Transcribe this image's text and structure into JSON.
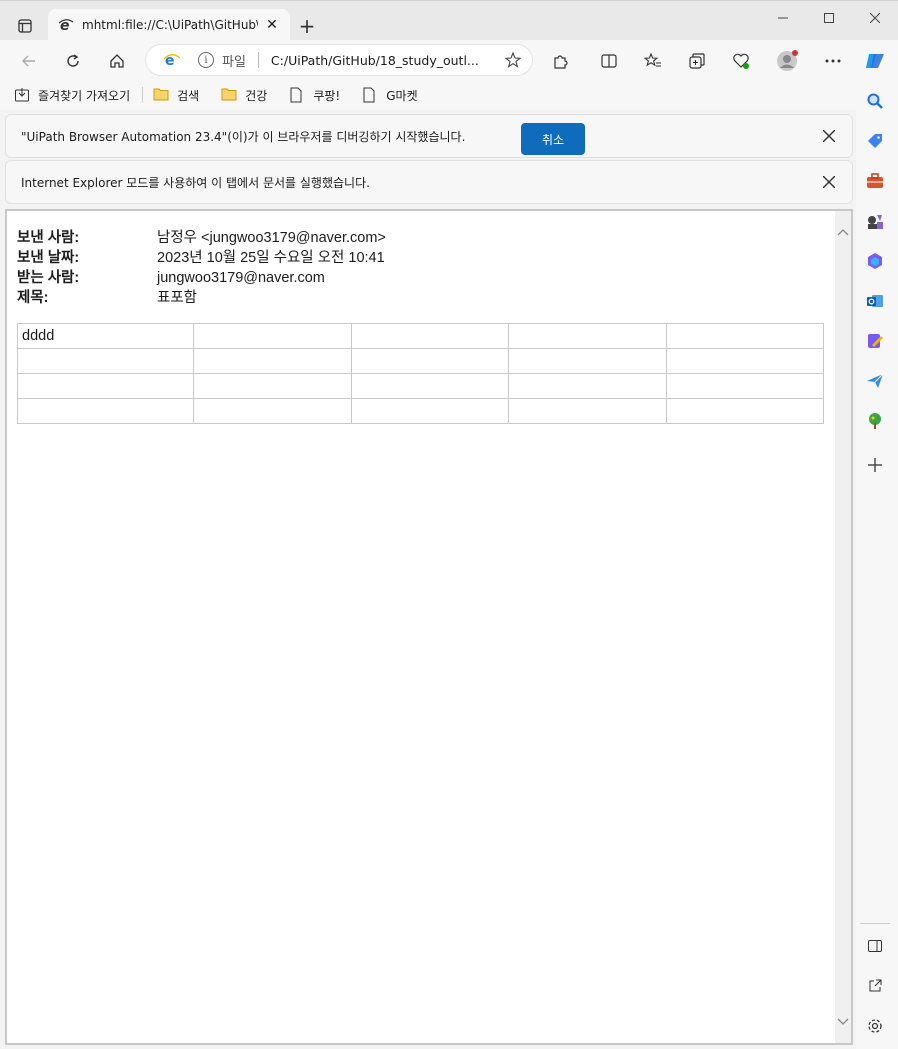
{
  "tab": {
    "title": "mhtml:file://C:\\UiPath\\GitHub\\18"
  },
  "address_bar": {
    "label": "파일",
    "url": "C:/UiPath/GitHub/18_study_outl..."
  },
  "bookmarks": [
    {
      "label": "즐겨찾기 가져오기",
      "icon": "import-icon"
    },
    {
      "label": "검색",
      "icon": "folder-icon"
    },
    {
      "label": "건강",
      "icon": "folder-icon"
    },
    {
      "label": "쿠팡!",
      "icon": "page-icon"
    },
    {
      "label": "G마켓",
      "icon": "page-icon"
    }
  ],
  "infobars": {
    "automation": {
      "message": "\"UiPath Browser Automation 23.4\"(이)가 이 브라우저를 디버깅하기 시작했습니다.",
      "cancel_label": "취소"
    },
    "ie_mode": {
      "message": "Internet Explorer 모드를 사용하여 이 탭에서 문서를 실행했습니다."
    }
  },
  "email": {
    "from_label": "보낸 사람:",
    "from_value": "남정우 <jungwoo3179@naver.com>",
    "date_label": "보낸 날짜:",
    "date_value": "2023년 10월 25일 수요일 오전 10:41",
    "to_label": "받는 사람:",
    "to_value": "jungwoo3179@naver.com",
    "subject_label": "제목:",
    "subject_value": "표포함"
  },
  "table": {
    "rows": [
      [
        "dddd",
        "",
        "",
        "",
        ""
      ],
      [
        "",
        "",
        "",
        "",
        ""
      ],
      [
        "",
        "",
        "",
        "",
        ""
      ],
      [
        "",
        "",
        "",
        "",
        ""
      ]
    ]
  }
}
